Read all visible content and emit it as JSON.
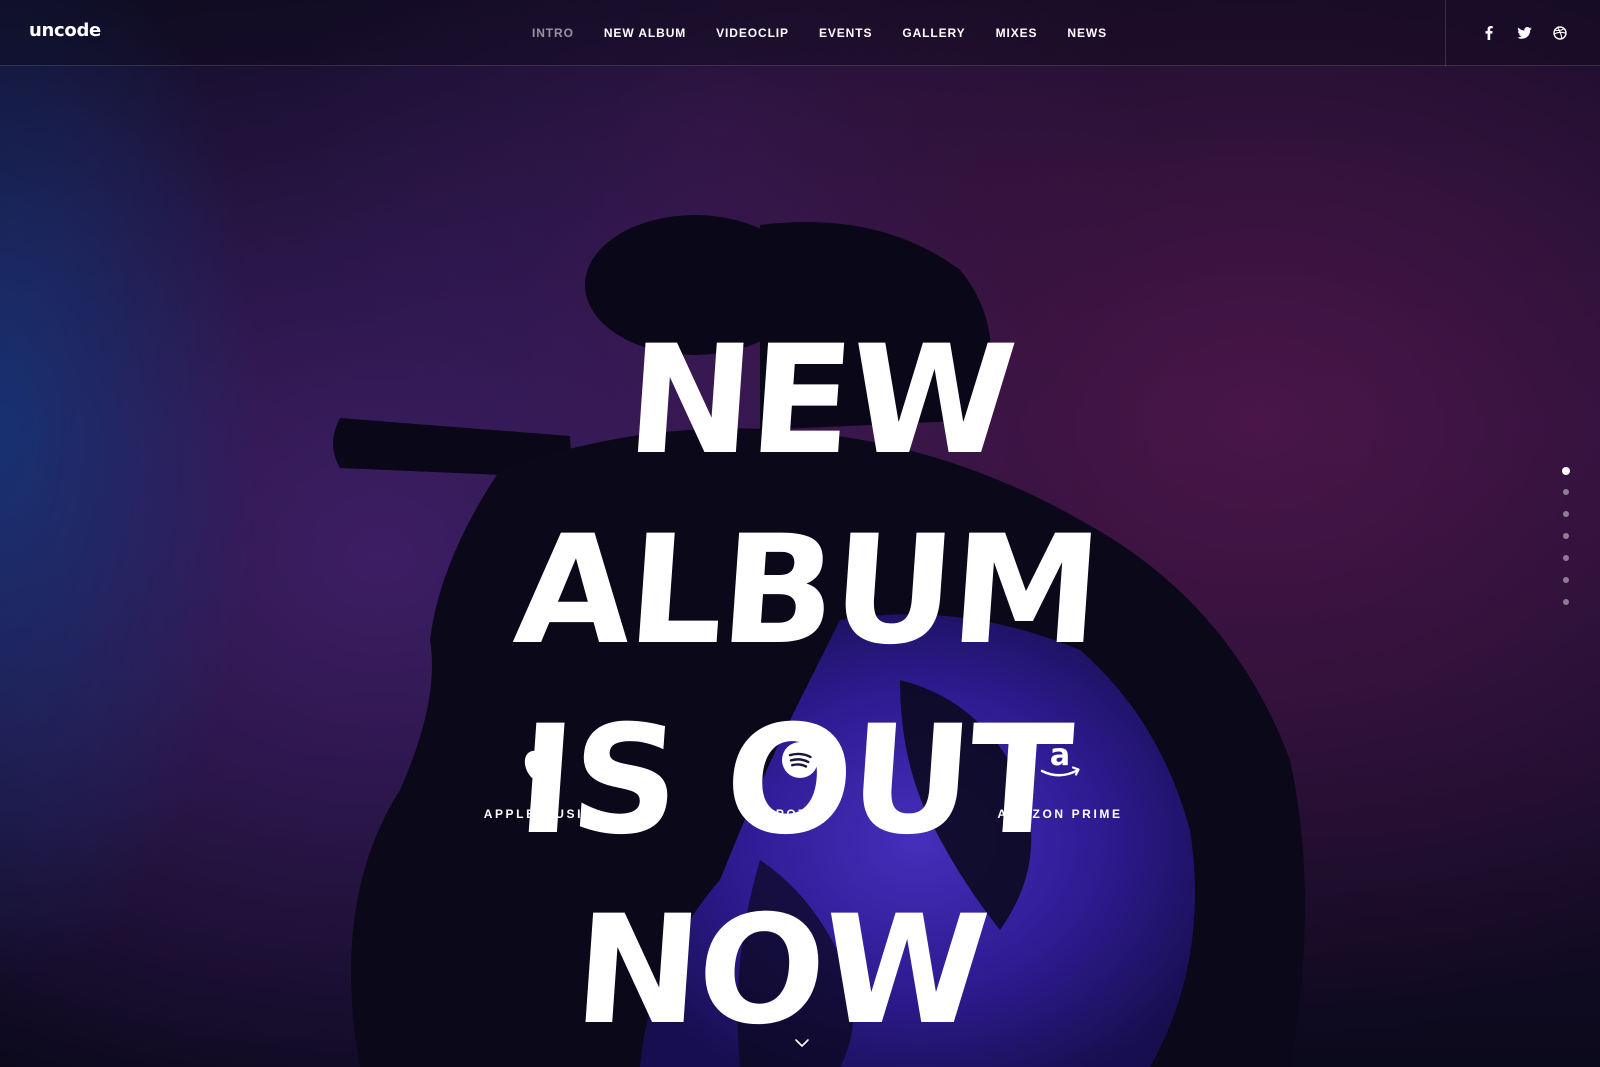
{
  "header": {
    "logo": "uncode",
    "nav": [
      {
        "label": "INTRO",
        "active": true
      },
      {
        "label": "NEW ALBUM"
      },
      {
        "label": "VIDEOCLIP"
      },
      {
        "label": "EVENTS"
      },
      {
        "label": "GALLERY"
      },
      {
        "label": "MIXES"
      },
      {
        "label": "NEWS"
      }
    ],
    "social": [
      "facebook-icon",
      "twitter-icon",
      "dribbble-icon"
    ]
  },
  "hero": {
    "headline_line1": "NEW ALBUM",
    "headline_line2": "IS OUT NOW",
    "services": [
      {
        "label": "APPLE MUSIC",
        "icon": "apple-icon"
      },
      {
        "label": "SPOTIFY",
        "icon": "spotify-icon"
      },
      {
        "label": "AMAZON PRIME",
        "icon": "amazon-icon"
      }
    ]
  },
  "section_dots": {
    "count": 7,
    "active_index": 0
  },
  "colors": {
    "background": "#0c0a1c",
    "accent_purple": "#4a2cd8",
    "magenta": "#7d1e64",
    "text": "#ffffff"
  }
}
